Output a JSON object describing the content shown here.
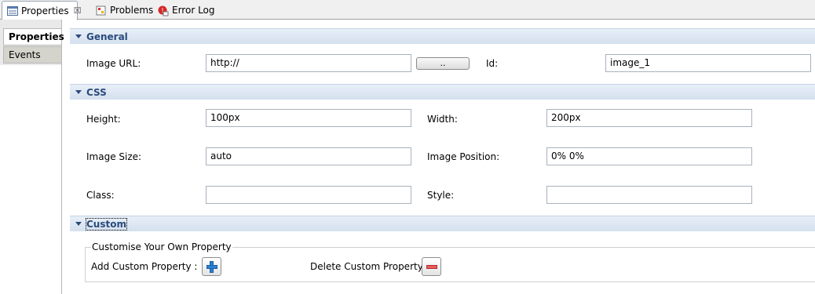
{
  "tabs": [
    {
      "label": "Properties",
      "close": "☒"
    },
    {
      "label": "Problems"
    },
    {
      "label": "Error Log"
    }
  ],
  "sidenav": {
    "items": [
      {
        "label": "Properties"
      },
      {
        "label": "Events"
      }
    ]
  },
  "general": {
    "title": "General",
    "image_url_label": "Image URL:",
    "image_url_value": "http://",
    "browse_label": "..",
    "id_label": "Id:",
    "id_value": "image_1"
  },
  "css": {
    "title": "CSS",
    "height_label": "Height:",
    "height_value": "100px",
    "width_label": "Width:",
    "width_value": "200px",
    "image_size_label": "Image Size:",
    "image_size_value": "auto",
    "image_position_label": "Image Position:",
    "image_position_value": "0% 0%",
    "class_label": "Class:",
    "class_value": "",
    "style_label": "Style:",
    "style_value": ""
  },
  "custom": {
    "title": "Custom",
    "group_title": "Customise Your Own Property",
    "add_label": "Add Custom Property :",
    "delete_label": "Delete Custom Property :"
  },
  "colors": {
    "section_title": "#2a4b7c",
    "add_icon": "#2b7fd0",
    "delete_icon": "#e85a5a"
  }
}
